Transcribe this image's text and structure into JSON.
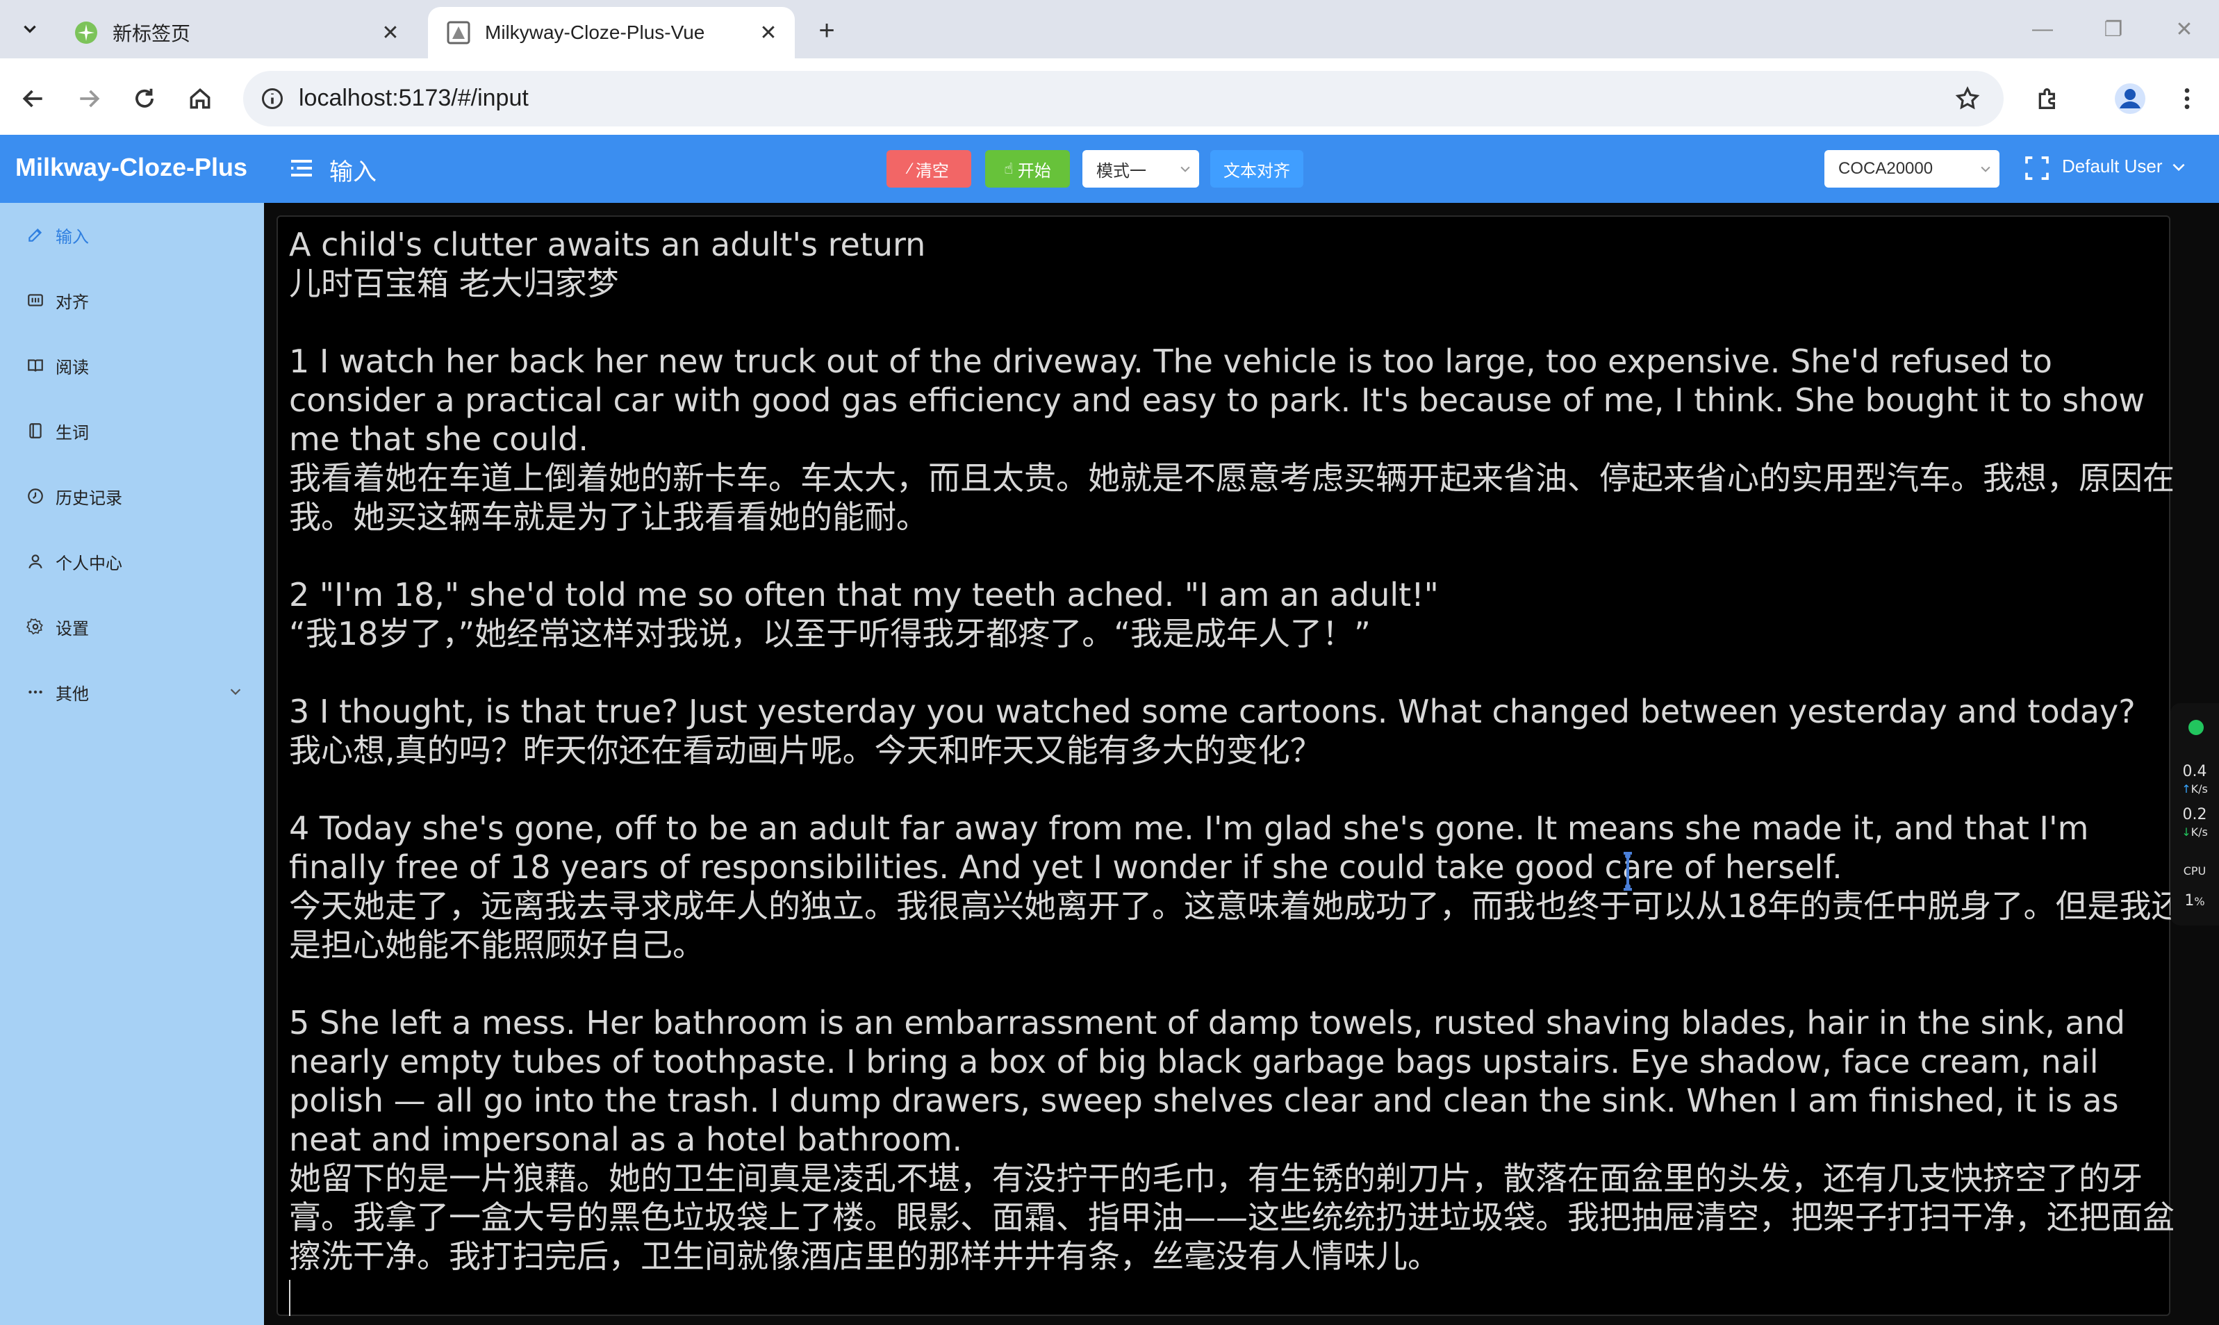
{
  "browser": {
    "tabs": [
      {
        "title": "新标签页",
        "active": false
      },
      {
        "title": "Milkyway-Cloze-Plus-Vue",
        "active": true
      }
    ],
    "url": "localhost:5173/#/input"
  },
  "app": {
    "brand": "Milkway-Cloze-Plus",
    "page_title": "输入",
    "buttons": {
      "clear": "清空",
      "start": "开始",
      "align": "文本对齐"
    },
    "mode_select": "模式一",
    "dict_select": "COCA20000",
    "user": "Default User",
    "colors": {
      "header": "#3b8ef0",
      "sidebar": "#a7d1f5",
      "clear": "#f26666",
      "start": "#67c23a",
      "align": "#409eff"
    }
  },
  "sidebar": {
    "items": [
      {
        "label": "输入",
        "icon": "edit-icon",
        "active": true
      },
      {
        "label": "对齐",
        "icon": "align-icon",
        "active": false
      },
      {
        "label": "阅读",
        "icon": "book-icon",
        "active": false
      },
      {
        "label": "生词",
        "icon": "notebook-icon",
        "active": false
      },
      {
        "label": "历史记录",
        "icon": "history-icon",
        "active": false
      },
      {
        "label": "个人中心",
        "icon": "user-icon",
        "active": false
      },
      {
        "label": "设置",
        "icon": "gear-icon",
        "active": false
      },
      {
        "label": "其他",
        "icon": "more-icon",
        "active": false
      }
    ]
  },
  "editor": {
    "lines": [
      "A child's clutter awaits an adult's return",
      "儿时百宝箱 老大归家梦",
      "",
      "1 I watch her back her new truck out of the driveway. The vehicle is too large, too expensive. She'd refused to consider a practical car with good gas efficiency and easy to park. It's because of me, I think. She bought it to show me that she could.",
      "我看着她在车道上倒着她的新卡车。车太大，而且太贵。她就是不愿意考虑买辆开起来省油、停起来省心的实用型汽车。我想，原因在我。她买这辆车就是为了让我看看她的能耐。",
      "",
      "2 \"I'm 18,\" she'd told me so often that my teeth ached. \"I am an adult!\"",
      "“我18岁了，”她经常这样对我说，以至于听得我牙都疼了。“我是成年人了！”",
      "",
      "3 I thought, is that true? Just yesterday you watched some cartoons. What changed between yesterday and today?",
      "我心想,真的吗？昨天你还在看动画片呢。今天和昨天又能有多大的变化？",
      "",
      "4 Today she's gone, off to be an adult far away from me. I'm glad she's gone. It means she made it, and that I'm finally free of 18 years of responsibilities. And yet I wonder if she could take good care of herself.",
      "今天她走了，远离我去寻求成年人的独立。我很高兴她离开了。这意味着她成功了，而我也终于可以从18年的责任中脱身了。但是我还是担心她能不能照顾好自己。",
      "",
      "5 She left a mess. Her bathroom is an embarrassment of damp towels, rusted shaving blades, hair in the sink, and nearly empty tubes of toothpaste. I bring a box of big black garbage bags upstairs. Eye shadow, face cream, nail polish — all go into the trash. I dump drawers, sweep shelves clear and clean the sink. When I am finished, it is as neat and impersonal as a hotel bathroom.",
      "她留下的是一片狼藉。她的卫生间真是凌乱不堪，有没拧干的毛巾，有生锈的剃刀片，散落在面盆里的头发，还有几支快挤空了的牙膏。我拿了一盒大号的黑色垃圾袋上了楼。眼影、面霜、指甲油——这些统统扔进垃圾袋。我把抽屉清空，把架子打扫干净，还把面盆擦洗干净。我打扫完后，卫生间就像酒店里的那样井井有条，丝毫没有人情味儿。"
    ]
  },
  "monitor": {
    "up": "0.4",
    "down": "0.2",
    "unit": "K/s",
    "cpu_label": "CPU",
    "cpu_value": "1",
    "cpu_unit": "%"
  }
}
